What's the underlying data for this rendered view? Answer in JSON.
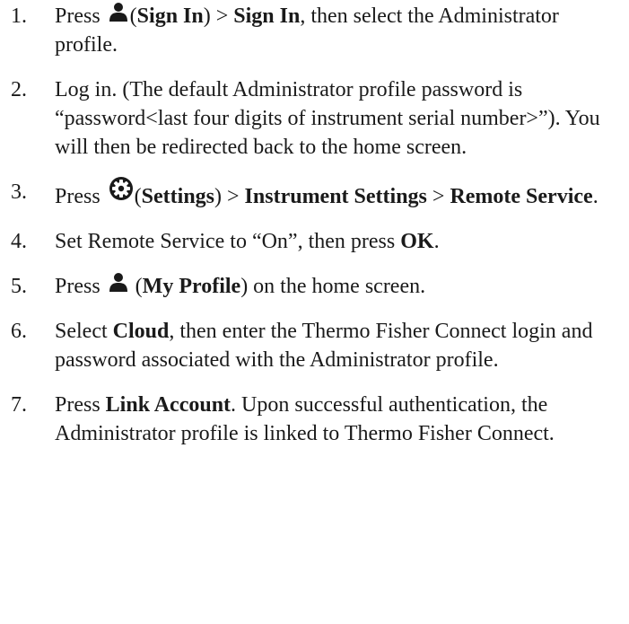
{
  "steps": [
    {
      "number": "1.",
      "t1": "Press",
      "icon": "person-icon",
      "t2": "(",
      "b1": "Sign In",
      "t3": ") > ",
      "b2": "Sign In",
      "t4": ", then select the Administrator profile."
    },
    {
      "number": "2.",
      "text": "Log in. (The default Administrator profile password is “password<last four digits of instrument serial number>”). You will then be redirected back to the home screen."
    },
    {
      "number": "3.",
      "t1": "Press",
      "icon": "gear-icon",
      "t2": "(",
      "b1": "Settings",
      "t3": ") > ",
      "b2": "Instrument Settings",
      "t4": " > ",
      "b3": "Remote Service",
      "t5": "."
    },
    {
      "number": "4.",
      "t1": "Set Remote Service to “On”, then press ",
      "b1": "OK",
      "t2": "."
    },
    {
      "number": "5.",
      "t1": "Press",
      "icon": "person-icon",
      "t2": " (",
      "b1": "My Profile",
      "t3": ") on the home screen."
    },
    {
      "number": "6.",
      "t1": "Select ",
      "b1": "Cloud",
      "t2": ", then enter the Thermo Fisher Connect login and password associated with the Administrator profile."
    },
    {
      "number": "7.",
      "t1": "Press ",
      "b1": "Link Account",
      "t2": ". Upon successful authentication, the Administrator profile is linked to Thermo Fisher Connect."
    }
  ]
}
